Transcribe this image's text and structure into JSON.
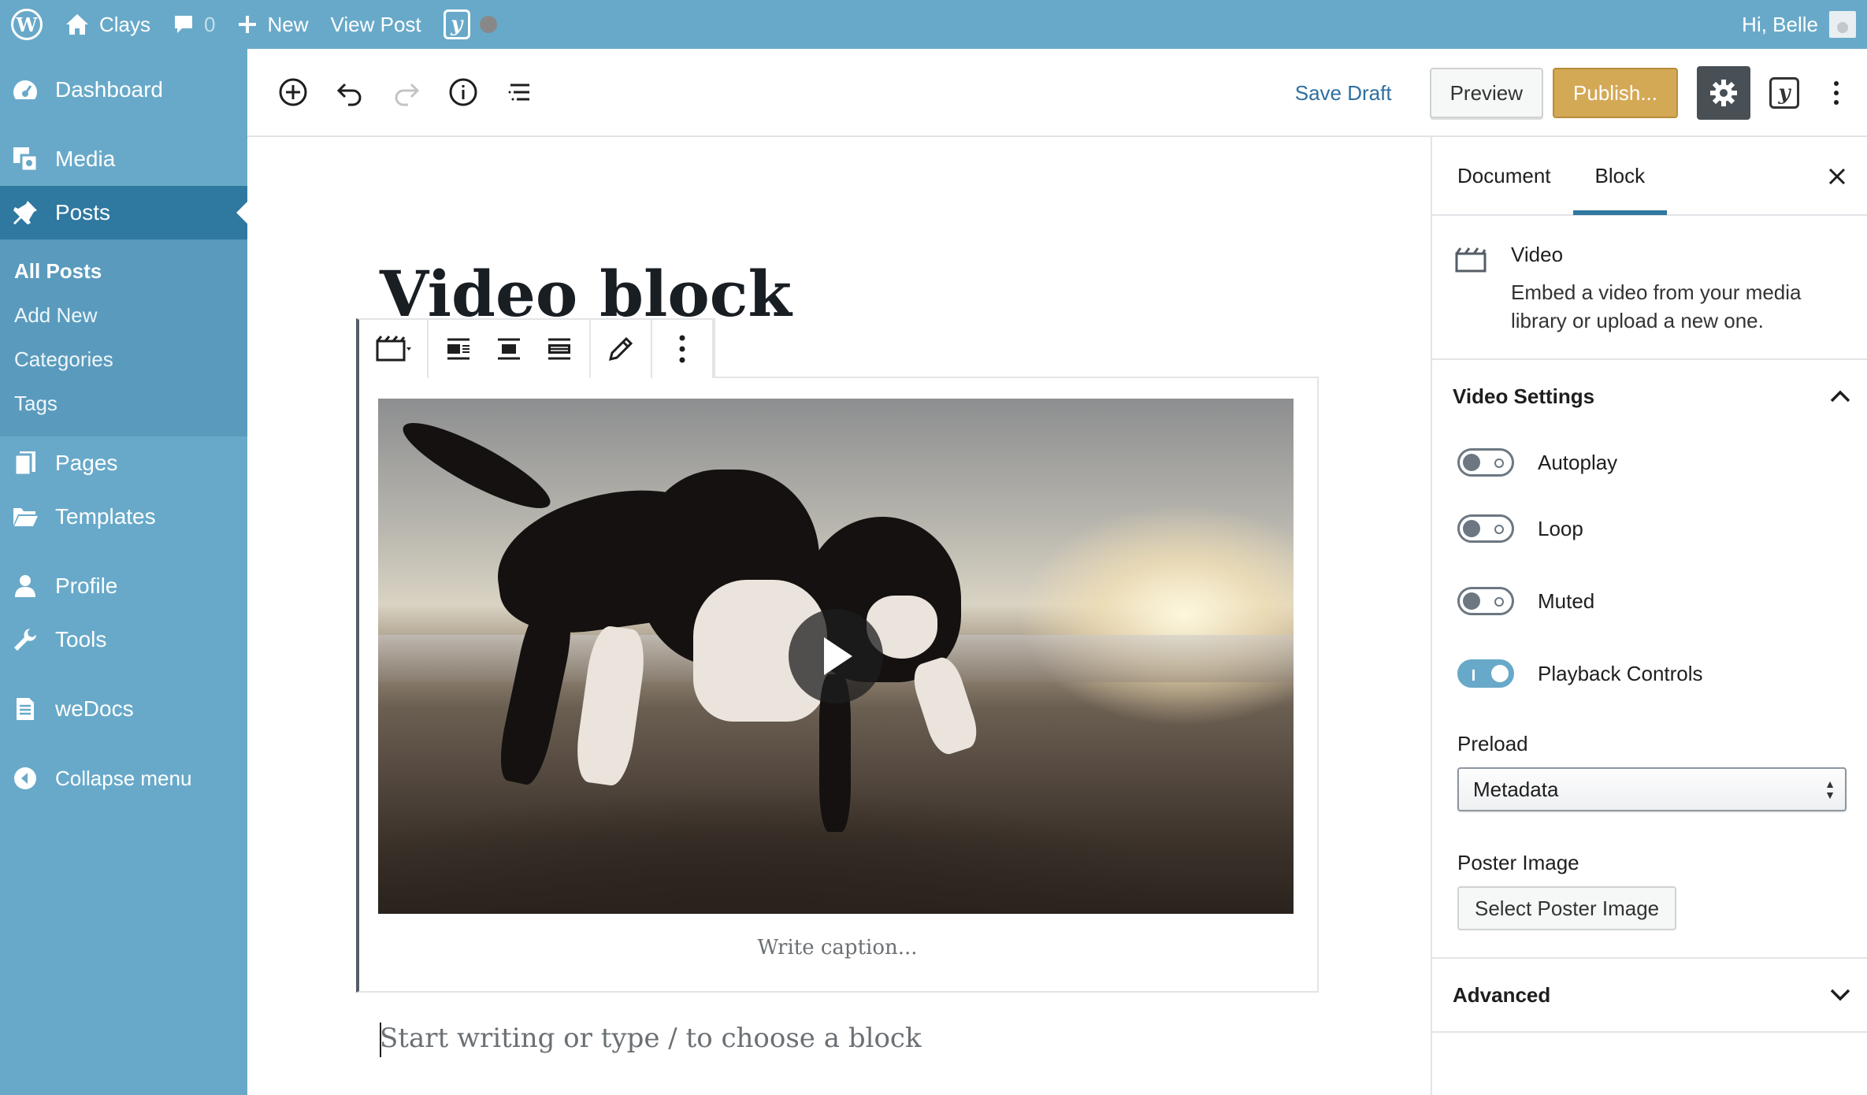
{
  "adminbar": {
    "site_name": "Clays",
    "comments_count": "0",
    "new_label": "New",
    "view_post_label": "View Post",
    "greeting": "Hi, Belle"
  },
  "sidebar": {
    "items": [
      {
        "label": "Dashboard",
        "icon": "dashboard-icon"
      },
      {
        "label": "Media",
        "icon": "media-icon"
      },
      {
        "label": "Posts",
        "icon": "pin-icon"
      },
      {
        "label": "Pages",
        "icon": "pages-icon"
      },
      {
        "label": "Templates",
        "icon": "folder-icon"
      },
      {
        "label": "Profile",
        "icon": "user-icon"
      },
      {
        "label": "Tools",
        "icon": "wrench-icon"
      },
      {
        "label": "weDocs",
        "icon": "doc-icon"
      },
      {
        "label": "Collapse menu",
        "icon": "collapse-icon"
      }
    ],
    "posts_submenu": [
      "All Posts",
      "Add New",
      "Categories",
      "Tags"
    ]
  },
  "header": {
    "save_draft": "Save Draft",
    "preview": "Preview",
    "publish": "Publish..."
  },
  "editor": {
    "title": "Video block",
    "caption_placeholder": "Write caption...",
    "appender_placeholder": "Start writing or type / to choose a block"
  },
  "settings": {
    "tabs": [
      "Document",
      "Block"
    ],
    "active_tab": "Block",
    "block": {
      "name": "Video",
      "description": "Embed a video from your media library or upload a new one."
    },
    "video_settings": {
      "title": "Video Settings",
      "toggles": [
        {
          "label": "Autoplay",
          "on": false
        },
        {
          "label": "Loop",
          "on": false
        },
        {
          "label": "Muted",
          "on": false
        },
        {
          "label": "Playback Controls",
          "on": true
        }
      ],
      "preload_label": "Preload",
      "preload_value": "Metadata",
      "poster_label": "Poster Image",
      "poster_button": "Select Poster Image"
    },
    "advanced_title": "Advanced"
  },
  "colors": {
    "admin_bar": "#68a9c9",
    "sidebar_current": "#2f78a0",
    "publish_button": "#d4a955",
    "link": "#2f6fa0"
  }
}
